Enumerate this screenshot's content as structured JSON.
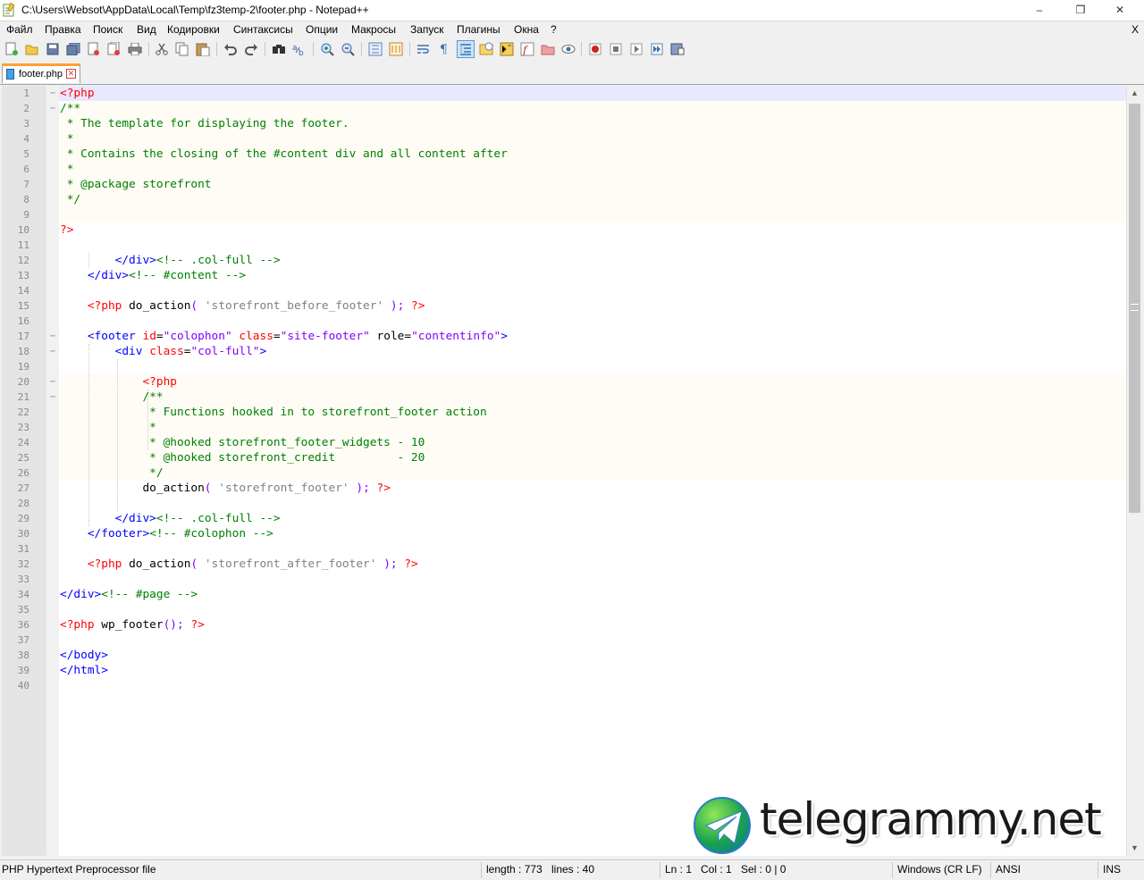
{
  "window": {
    "title": "C:\\Users\\Websot\\AppData\\Local\\Temp\\fz3temp-2\\footer.php - Notepad++",
    "minimize": "–",
    "maximize": "❒",
    "close": "✕"
  },
  "menu": {
    "items": [
      "Файл",
      "Правка",
      "Поиск",
      "Вид",
      "Кодировки",
      "Синтаксисы",
      "Опции",
      "Макросы",
      "Запуск",
      "Плагины",
      "Окна",
      "?"
    ],
    "close": "X"
  },
  "toolbar": {
    "buttons": [
      "new-file-icon",
      "open-file-icon",
      "save-icon",
      "save-all-icon",
      "close-icon",
      "close-all-icon",
      "print-icon",
      "cut-icon",
      "copy-icon",
      "paste-icon",
      "undo-icon",
      "redo-icon",
      "find-icon",
      "replace-icon",
      "zoom-in-icon",
      "zoom-out-icon",
      "sync-vertical-icon",
      "sync-horizontal-icon",
      "word-wrap-icon",
      "show-all-chars-icon",
      "indent-guide-icon",
      "udl-icon",
      "doc-map-icon",
      "function-list-icon",
      "folder-workspace-icon",
      "monitoring-icon",
      "record-macro-icon",
      "stop-macro-icon",
      "play-macro-icon",
      "run-macro-multiple-icon",
      "save-macro-icon"
    ]
  },
  "tab": {
    "label": "footer.php",
    "close": "✕"
  },
  "editor": {
    "lines": [
      "<?php",
      "/**",
      " * The template for displaying the footer.",
      " *",
      " * Contains the closing of the #content div and all content after",
      " *",
      " * @package storefront",
      " */",
      "",
      "?>",
      "",
      "        </div><!-- .col-full -->",
      "    </div><!-- #content -->",
      "",
      "    <?php do_action( 'storefront_before_footer' ); ?>",
      "",
      "    <footer id=\"colophon\" class=\"site-footer\" role=\"contentinfo\">",
      "        <div class=\"col-full\">",
      "",
      "            <?php",
      "            /**",
      "             * Functions hooked in to storefront_footer action",
      "             *",
      "             * @hooked storefront_footer_widgets - 10",
      "             * @hooked storefront_credit         - 20",
      "             */",
      "            do_action( 'storefront_footer' ); ?>",
      "",
      "        </div><!-- .col-full -->",
      "    </footer><!-- #colophon -->",
      "",
      "    <?php do_action( 'storefront_after_footer' ); ?>",
      "",
      "</div><!-- #page -->",
      "",
      "<?php wp_footer(); ?>",
      "",
      "</body>",
      "</html>",
      ""
    ]
  },
  "watermark": {
    "text": "telegrammy.net"
  },
  "status": {
    "language": "PHP Hypertext Preprocessor file",
    "length": "length : 773",
    "lines": "lines : 40",
    "ln": "Ln : 1",
    "col": "Col : 1",
    "sel": "Sel : 0 | 0",
    "eol": "Windows (CR LF)",
    "encoding": "ANSI",
    "mode": "INS"
  },
  "colors": {
    "php_delim": "#ff0000",
    "comment": "#008000",
    "tag": "#0000ff",
    "attr_value": "#8000ff",
    "string": "#808080",
    "current_line": "#e8e8ff",
    "tab_accent": "#ffa033"
  }
}
